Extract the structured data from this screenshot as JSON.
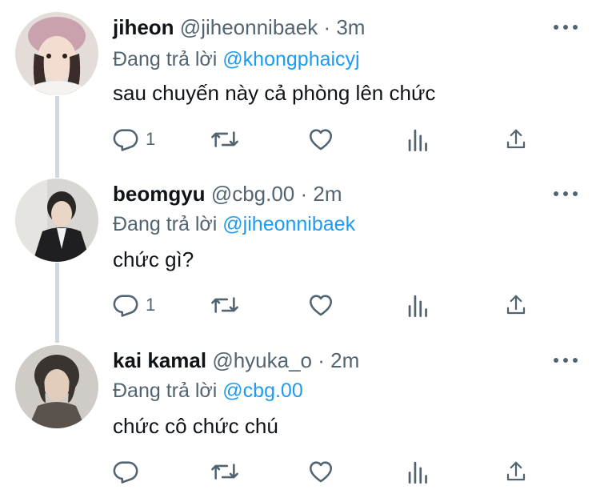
{
  "tweets": [
    {
      "name": "jiheon",
      "handle": "@jiheonnibaek",
      "dot": "·",
      "time": "3m",
      "reply_prefix": "Đang trả lời",
      "reply_to": "@khongphaicyj",
      "text": "sau chuyến này cả phòng lên chức",
      "reply_count": "1"
    },
    {
      "name": "beomgyu",
      "handle": "@cbg.00",
      "dot": "·",
      "time": "2m",
      "reply_prefix": "Đang trả lời",
      "reply_to": "@jiheonnibaek",
      "text": "chức gì?",
      "reply_count": "1"
    },
    {
      "name": "kai kamal",
      "handle": "@hyuka_o",
      "dot": "·",
      "time": "2m",
      "reply_prefix": "Đang trả lời",
      "reply_to": "@cbg.00",
      "text": "chức cô chức chú",
      "reply_count": ""
    }
  ],
  "colors": {
    "accent": "#1d9bf0",
    "secondary_text": "#536471",
    "thread_line": "#cfd9de"
  },
  "icons": [
    "more-icon",
    "reply-icon",
    "retweet-icon",
    "like-icon",
    "views-icon",
    "share-icon"
  ]
}
